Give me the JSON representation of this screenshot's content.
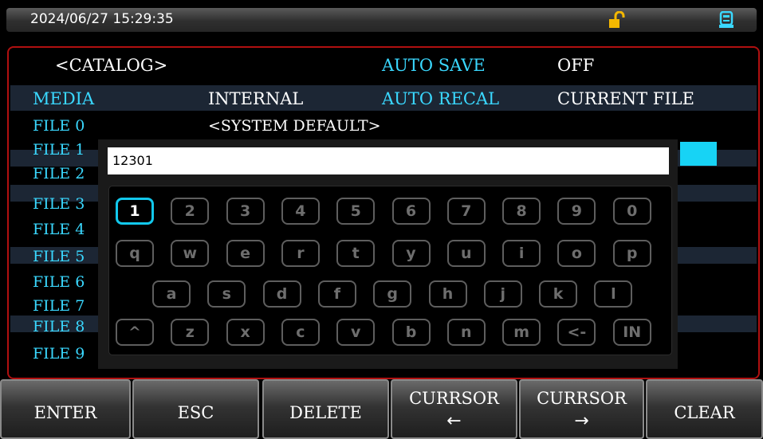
{
  "status_bar": {
    "datetime": "2024/06/27  15:29:35",
    "lock_icon": "unlocked-padlock-icon",
    "device_icon": "usb-device-icon"
  },
  "header": {
    "catalog": "<CATALOG>",
    "auto_save_label": "AUTO SAVE",
    "auto_save_value": "OFF",
    "media_label": "MEDIA",
    "media_value": "INTERNAL",
    "auto_recal_label": "AUTO RECAL",
    "auto_recal_value": "CURRENT FILE"
  },
  "files": [
    "FILE 0",
    "FILE 1",
    "FILE 2",
    "FILE 3",
    "FILE 4",
    "FILE 5",
    "FILE 6",
    "FILE 7",
    "FILE 8",
    "FILE 9"
  ],
  "file0_value": "<SYSTEM DEFAULT>",
  "dialog": {
    "input_value": "12301",
    "keyboard": {
      "row1": [
        "1",
        "2",
        "3",
        "4",
        "5",
        "6",
        "7",
        "8",
        "9",
        "0"
      ],
      "row2": [
        "q",
        "w",
        "e",
        "r",
        "t",
        "y",
        "u",
        "i",
        "o",
        "p"
      ],
      "row3": [
        "a",
        "s",
        "d",
        "f",
        "g",
        "h",
        "j",
        "k",
        "l"
      ],
      "row4": [
        "^",
        "z",
        "x",
        "c",
        "v",
        "b",
        "n",
        "m",
        "<-",
        "IN"
      ],
      "selected_key": "1"
    }
  },
  "softkeys": [
    {
      "label": "ENTER"
    },
    {
      "label": "ESC"
    },
    {
      "label": "DELETE"
    },
    {
      "label": "CURRSOR",
      "arrow": "←"
    },
    {
      "label": "CURRSOR",
      "arrow": "→"
    },
    {
      "label": "CLEAR"
    }
  ],
  "colors": {
    "accent": "#3ad8ff",
    "border": "#b01010",
    "selected_key": "#12c8ec"
  }
}
